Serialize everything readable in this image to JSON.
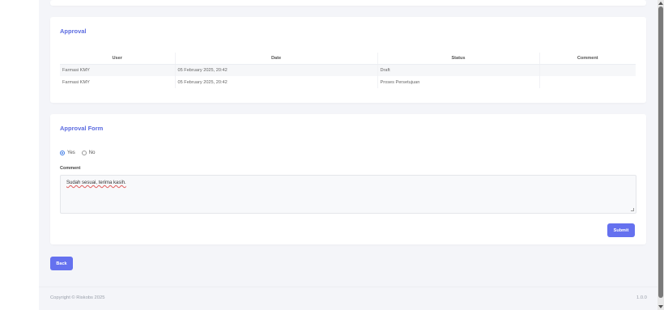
{
  "approval": {
    "title": "Approval",
    "columns": [
      "User",
      "Date",
      "Status",
      "Comment"
    ],
    "rows": [
      {
        "user": "Farmasi KMY",
        "date": "05 February 2025, 20:42",
        "status": "Draft",
        "comment": ""
      },
      {
        "user": "Farmasi KMY",
        "date": "05 February 2025, 20:42",
        "status": "Proses Persetujuan",
        "comment": ""
      }
    ]
  },
  "form": {
    "title": "Approval Form",
    "options": [
      "Yes",
      "No"
    ],
    "selected": "Yes",
    "comment_label": "Comment",
    "comment_value": "Sudah sesuai, terima kasih.",
    "submit_label": "Submit"
  },
  "back_label": "Back",
  "footer": {
    "copyright": "Copyright © Riskobs 2025",
    "version": "1.0.0"
  },
  "colors": {
    "accent": "#6571ef",
    "title": "#5b6be0",
    "radio": "#3d7be6",
    "page_bg": "#f4f5f9"
  }
}
